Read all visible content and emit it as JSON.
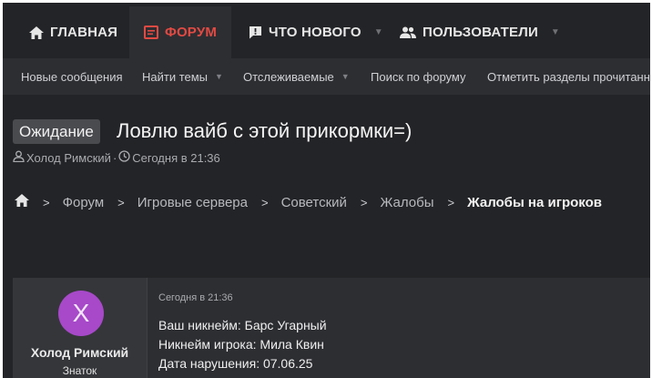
{
  "nav": {
    "tabs": [
      {
        "label": "ГЛАВНАЯ",
        "icon": "home-icon"
      },
      {
        "label": "ФОРУМ",
        "icon": "forum-icon"
      },
      {
        "label": "ЧТО НОВОГО",
        "icon": "whats-new-icon"
      },
      {
        "label": "ПОЛЬЗОВАТЕЛИ",
        "icon": "users-icon"
      }
    ],
    "active_color": "#e24a43"
  },
  "subnav": {
    "items": [
      {
        "label": "Новые сообщения"
      },
      {
        "label": "Найти темы"
      },
      {
        "label": "Отслеживаемые"
      },
      {
        "label": "Поиск по форуму"
      },
      {
        "label": "Отметить разделы прочитанными"
      }
    ]
  },
  "thread": {
    "prefix": "Ожидание",
    "title": "Ловлю вайб с этой прикормки=)",
    "author": "Холод Римский",
    "meta_separator": "·",
    "date": "Сегодня в 21:36"
  },
  "breadcrumb": {
    "items": [
      "Форум",
      "Игровые сервера",
      "Советский",
      "Жалобы"
    ],
    "current": "Жалобы на игроков"
  },
  "post": {
    "avatar_letter": "X",
    "avatar_color": "#a749c9",
    "username": "Холод Римский",
    "user_title": "Знаток",
    "time": "Сегодня в 21:36",
    "lines": [
      "Ваш никнейм: Барс Угарный",
      "Никнейм игрока: Мила Квин",
      "Дата нарушения: 07.06.25"
    ]
  }
}
